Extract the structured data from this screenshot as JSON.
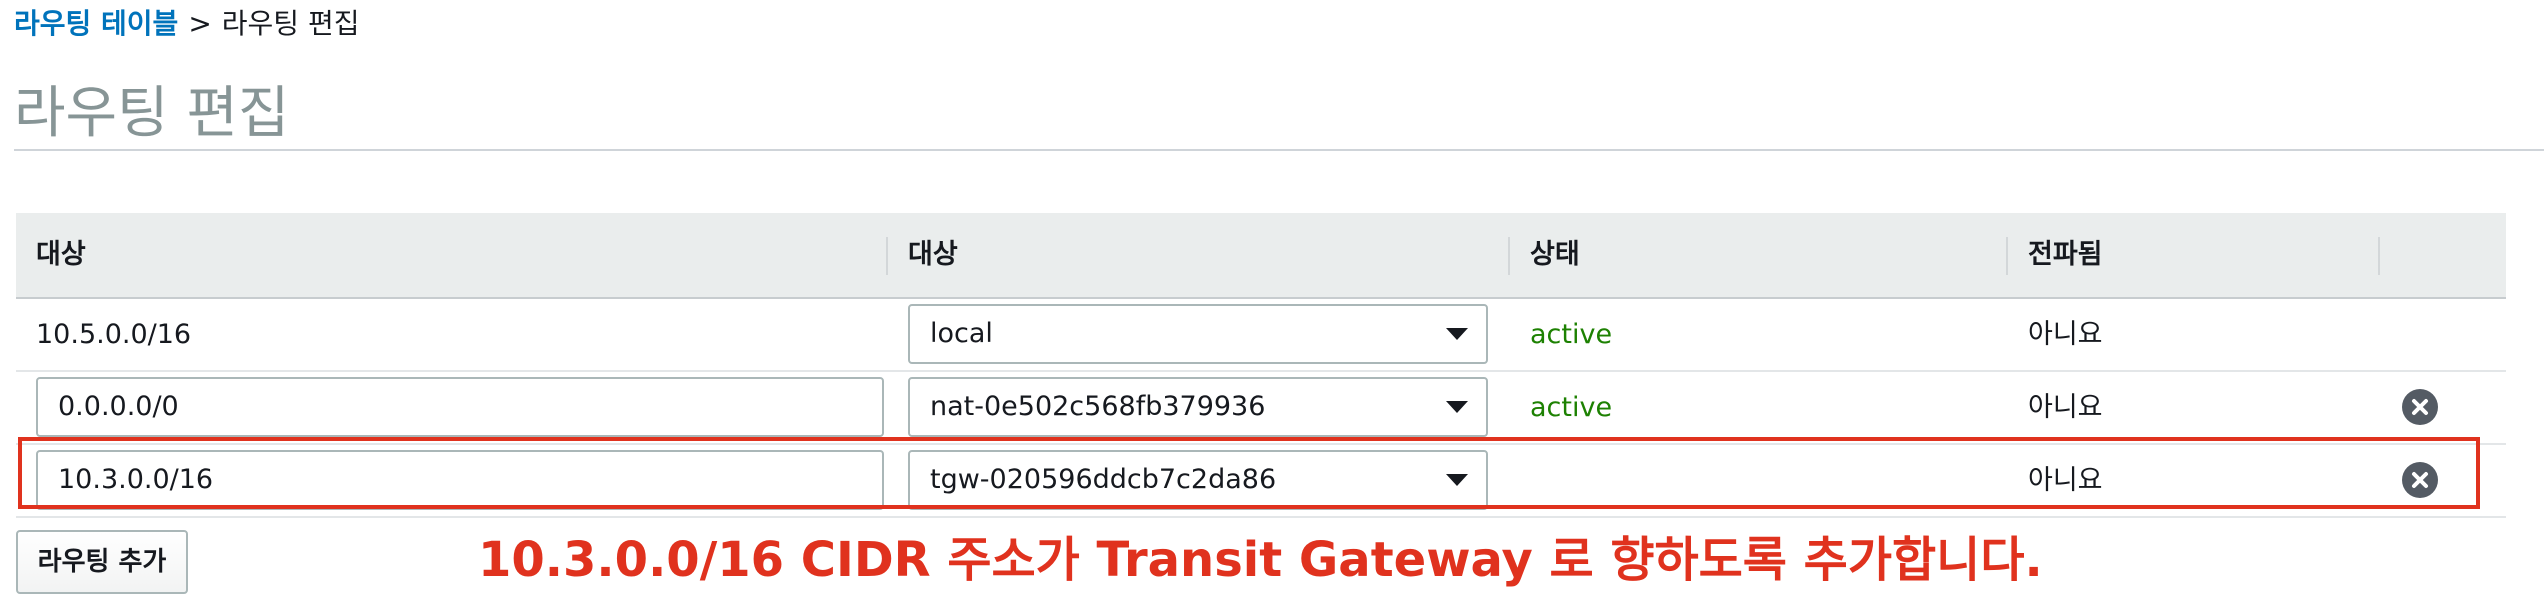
{
  "breadcrumb": {
    "parent": "라우팅 테이블",
    "separator": ">",
    "current": "라우팅 편집"
  },
  "page_title": "라우팅 편집",
  "table": {
    "headers": [
      "대상",
      "대상",
      "상태",
      "전파됨"
    ],
    "rows": [
      {
        "destination": "10.5.0.0/16",
        "target": "local",
        "status": "active",
        "propagated": "아니요",
        "removable": false
      },
      {
        "destination": "0.0.0.0/0",
        "target": "nat-0e502c568fb379936",
        "status": "active",
        "propagated": "아니요",
        "removable": true
      },
      {
        "destination": "10.3.0.0/16",
        "target": "tgw-020596ddcb7c2da86",
        "status": "",
        "propagated": "아니요",
        "removable": true
      }
    ]
  },
  "add_route_button": "라우팅 추가",
  "annotation": "10.3.0.0/16 CIDR 주소가 Transit Gateway 로 향하도록 추가합니다.",
  "colors": {
    "link": "#0073bb",
    "active": "#1d8102",
    "highlight": "#e0321e",
    "title": "#879596"
  },
  "icons": [
    "remove-route-icon",
    "dropdown-caret-icon"
  ]
}
